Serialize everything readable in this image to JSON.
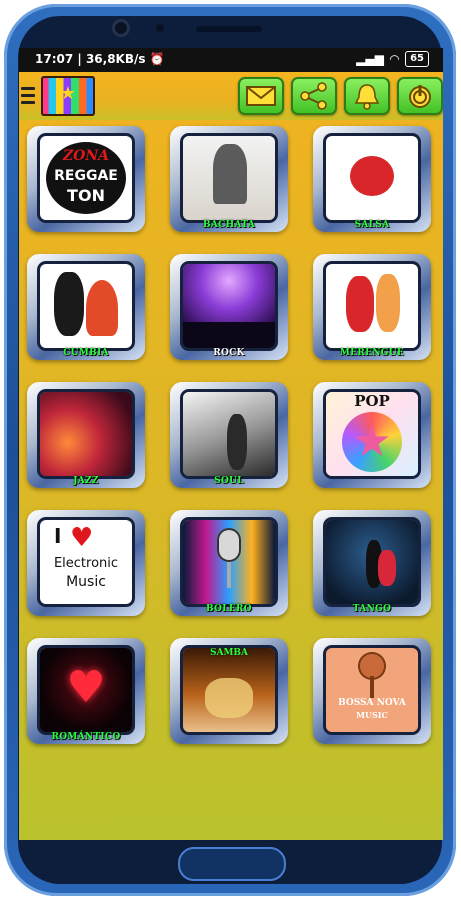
{
  "status_bar": {
    "time": "17:07",
    "speed": "36,8KB/s",
    "battery": "65"
  },
  "toolbar": {
    "buttons": [
      "mail-icon",
      "share-icon",
      "bell-icon",
      "power-icon"
    ]
  },
  "genres": [
    {
      "label": "ZONA DE REGGAETON",
      "top_text": "ZONA",
      "mid_text": "REGGAE",
      "bot_text": "TON"
    },
    {
      "label": "BACHATA"
    },
    {
      "label": "SALSA"
    },
    {
      "label": "CUMBIA"
    },
    {
      "label": "ROCK"
    },
    {
      "label": "MERENGUE"
    },
    {
      "label": "JAZZ"
    },
    {
      "label": "SOUL"
    },
    {
      "label": "POP"
    },
    {
      "label": "Electronic Music",
      "line1": "I",
      "line2": "Electronic",
      "line3": "Music"
    },
    {
      "label": "BOLERO"
    },
    {
      "label": "TANGO"
    },
    {
      "label": "ROMÁNTICO"
    },
    {
      "label": "SAMBA"
    },
    {
      "label": "BOSSA NOVA MUSIC",
      "line1": "BOSSA NOVA",
      "line2": "MUSIC"
    }
  ],
  "colors": {
    "accent_green": "#2bff3a",
    "background": "#f2b21d"
  }
}
